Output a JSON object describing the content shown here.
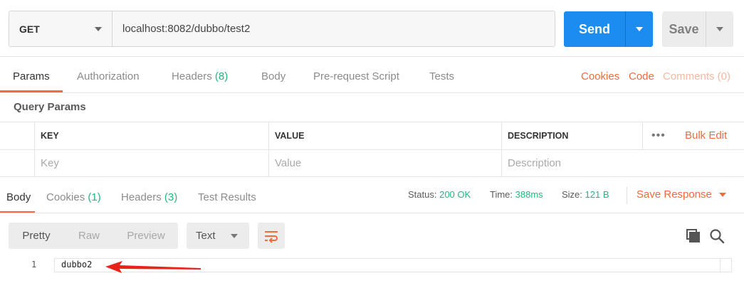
{
  "request": {
    "method": "GET",
    "url": "localhost:8082/dubbo/test2",
    "send_label": "Send",
    "save_label": "Save"
  },
  "request_tabs": {
    "params": "Params",
    "authorization": "Authorization",
    "headers": "Headers",
    "headers_count": "(8)",
    "body": "Body",
    "prerequest": "Pre-request Script",
    "tests": "Tests",
    "cookies": "Cookies",
    "code": "Code",
    "comments": "Comments (0)"
  },
  "query_params": {
    "title": "Query Params",
    "columns": {
      "key": "KEY",
      "value": "VALUE",
      "description": "DESCRIPTION"
    },
    "more": "•••",
    "bulk_edit": "Bulk Edit",
    "placeholders": {
      "key": "Key",
      "value": "Value",
      "description": "Description"
    }
  },
  "response_tabs": {
    "body": "Body",
    "cookies": "Cookies",
    "cookies_count": "(1)",
    "headers": "Headers",
    "headers_count": "(3)",
    "test_results": "Test Results"
  },
  "response_status": {
    "status_label": "Status:",
    "status_value": "200 OK",
    "time_label": "Time:",
    "time_value": "388ms",
    "size_label": "Size:",
    "size_value": "121 B",
    "save_response": "Save Response"
  },
  "response_view": {
    "pretty": "Pretty",
    "raw": "Raw",
    "preview": "Preview",
    "format": "Text"
  },
  "response_body": {
    "lines": [
      {
        "number": "1",
        "text": "dubbo2"
      }
    ]
  },
  "colors": {
    "accent": "#f26b3a",
    "send_blue": "#1d8cf0",
    "success_green": "#26b47f",
    "annotation_arrow": "#e8231b"
  },
  "icons": {
    "wrap": "wrap-lines-icon",
    "copy": "copy-icon",
    "search": "search-icon",
    "arrow": "red-annotation-arrow"
  }
}
